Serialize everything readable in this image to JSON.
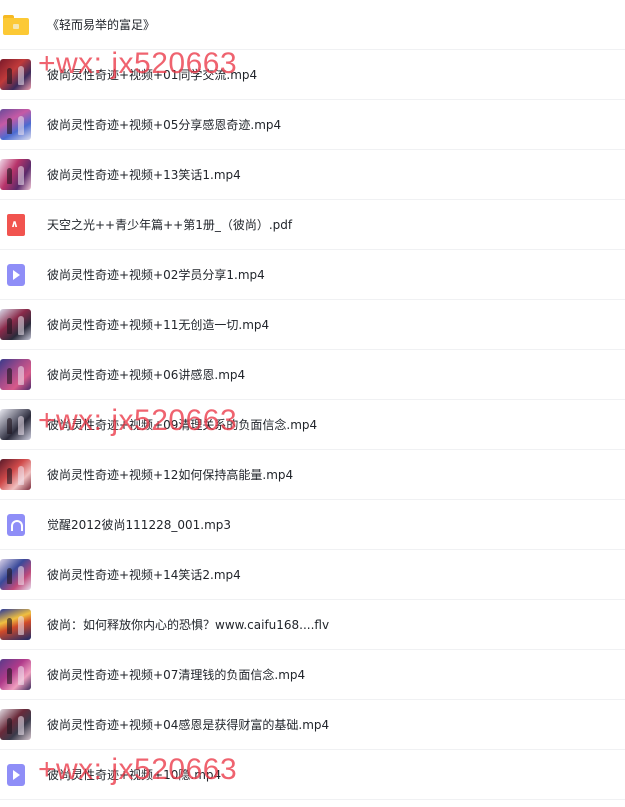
{
  "files": [
    {
      "name": "《轻而易举的富足》",
      "type": "folder"
    },
    {
      "name": "彼尚灵性奇迹+视频+01同学交流.mp4",
      "type": "video-thumb",
      "thumb": "t1"
    },
    {
      "name": "彼尚灵性奇迹+视频+05分享感恩奇迹.mp4",
      "type": "video-thumb",
      "thumb": "t2"
    },
    {
      "name": "彼尚灵性奇迹+视频+13笑话1.mp4",
      "type": "video-thumb",
      "thumb": "t3"
    },
    {
      "name": "天空之光++青少年篇++第1册_（彼尚）.pdf",
      "type": "pdf"
    },
    {
      "name": "彼尚灵性奇迹+视频+02学员分享1.mp4",
      "type": "video"
    },
    {
      "name": "彼尚灵性奇迹+视频+11无创造一切.mp4",
      "type": "video-thumb",
      "thumb": "t4"
    },
    {
      "name": "彼尚灵性奇迹+视频+06讲感恩.mp4",
      "type": "video-thumb",
      "thumb": "t5"
    },
    {
      "name": "彼尚灵性奇迹+视频+09清理关系的负面信念.mp4",
      "type": "video-thumb",
      "thumb": "t6"
    },
    {
      "name": "彼尚灵性奇迹+视频+12如何保持高能量.mp4",
      "type": "video-thumb",
      "thumb": "t7"
    },
    {
      "name": "觉醒2012彼尚111228_001.mp3",
      "type": "audio"
    },
    {
      "name": "彼尚灵性奇迹+视频+14笑话2.mp4",
      "type": "video-thumb",
      "thumb": "t8"
    },
    {
      "name": "彼尚：如何释放你内心的恐惧？www.caifu168....flv",
      "type": "video-thumb",
      "thumb": "t9"
    },
    {
      "name": "彼尚灵性奇迹+视频+07清理钱的负面信念.mp4",
      "type": "video-thumb",
      "thumb": "t10"
    },
    {
      "name": "彼尚灵性奇迹+视频+04感恩是获得财富的基础.mp4",
      "type": "video-thumb",
      "thumb": "t11"
    },
    {
      "name": "彼尚灵性奇迹+视频+10隐.mp4",
      "type": "video"
    }
  ],
  "watermark": {
    "text": "+wx: jx520663",
    "color": "#eb3746"
  },
  "icons": {
    "folder": "folder-icon",
    "video-thumb": "video-thumbnail-icon",
    "video": "video-file-icon",
    "pdf": "pdf-file-icon",
    "audio": "audio-file-icon"
  }
}
